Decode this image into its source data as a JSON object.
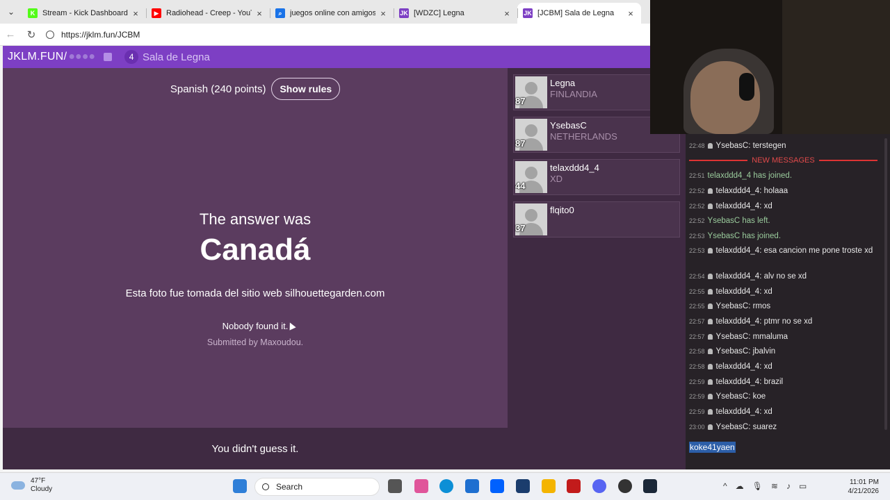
{
  "browser": {
    "tabs": [
      {
        "title": "Stream - Kick Dashboard",
        "favicon": "kick-logo",
        "color": "#53fc18",
        "glyph": "K"
      },
      {
        "title": "Radiohead - Creep - YouTube",
        "favicon": "youtube-logo",
        "color": "#ff0000",
        "glyph": "▶"
      },
      {
        "title": "juegos online con amigos - S",
        "favicon": "search-icon",
        "color": "#1a73e8",
        "glyph": "⌕"
      },
      {
        "title": "[WDZC] Legna",
        "favicon": "jklm-logo",
        "color": "#7d3fc4",
        "glyph": "JK"
      },
      {
        "title": "[JCBM] Sala de Legna",
        "favicon": "jklm-logo",
        "color": "#7d3fc4",
        "glyph": "JK"
      }
    ],
    "url": "https://jklm.fun/JCBM"
  },
  "site": {
    "brand": "JKLM.FUN/",
    "masked_code": "●●●●",
    "player_count": "4",
    "room_name": "Sala de Legna",
    "accent": "#7d3fc4"
  },
  "game": {
    "language": "Spanish (240 points)",
    "rules_label": "Show rules",
    "answer_intro": "The answer was",
    "answer": "Canadá",
    "photo_note": "Esta foto fue tomada del sitio web silhouettegarden.com",
    "found_text": "Nobody found it.",
    "submitted": "Submitted by Maxoudou.",
    "footer": "You didn't guess it."
  },
  "players": [
    {
      "name": "Legna",
      "country": "FINLANDIA",
      "score": "87"
    },
    {
      "name": "YsebasC",
      "country": "NETHERLANDS",
      "score": "87"
    },
    {
      "name": "telaxddd4_4",
      "country": "XD",
      "score": "44"
    },
    {
      "name": "flqito0",
      "country": "",
      "score": "37"
    }
  ],
  "chat": {
    "new_messages_label": "NEW MESSAGES",
    "input_value": "koke41yaen",
    "messages": [
      {
        "time": "22:48",
        "user": "YsebasC",
        "text": ": terstegen",
        "system": false
      },
      {
        "time": "22:51",
        "user": "",
        "text": "telaxddd4_4 has joined.",
        "system": true
      },
      {
        "time": "22:52",
        "user": "telaxddd4_4",
        "text": ": holaaa",
        "system": false
      },
      {
        "time": "22:52",
        "user": "telaxddd4_4",
        "text": ": xd",
        "system": false
      },
      {
        "time": "22:52",
        "user": "",
        "text": "YsebasC has left.",
        "system": true
      },
      {
        "time": "22:53",
        "user": "",
        "text": "YsebasC has joined.",
        "system": true
      },
      {
        "time": "22:53",
        "user": "telaxddd4_4",
        "text": ": esa cancion me pone troste xd",
        "system": false
      },
      {
        "time": "22:54",
        "user": "telaxddd4_4",
        "text": ": alv no se xd",
        "system": false
      },
      {
        "time": "22:55",
        "user": "telaxddd4_4",
        "text": ": xd",
        "system": false
      },
      {
        "time": "22:55",
        "user": "YsebasC",
        "text": ": rmos",
        "system": false
      },
      {
        "time": "22:57",
        "user": "telaxddd4_4",
        "text": ": ptmr no se xd",
        "system": false
      },
      {
        "time": "22:57",
        "user": "YsebasC",
        "text": ": mmaluma",
        "system": false
      },
      {
        "time": "22:58",
        "user": "YsebasC",
        "text": ": jbalvin",
        "system": false
      },
      {
        "time": "22:58",
        "user": "telaxddd4_4",
        "text": ": xd",
        "system": false
      },
      {
        "time": "22:59",
        "user": "telaxddd4_4",
        "text": ": brazil",
        "system": false
      },
      {
        "time": "22:59",
        "user": "YsebasC",
        "text": ": koe",
        "system": false
      },
      {
        "time": "22:59",
        "user": "telaxddd4_4",
        "text": ": xd",
        "system": false
      },
      {
        "time": "23:00",
        "user": "YsebasC",
        "text": ": suarez",
        "system": false
      }
    ]
  },
  "taskbar": {
    "temp": "47°F",
    "weather": "Cloudy",
    "search": "Search",
    "time": "11:01 PM",
    "date": "4/21/2026"
  }
}
